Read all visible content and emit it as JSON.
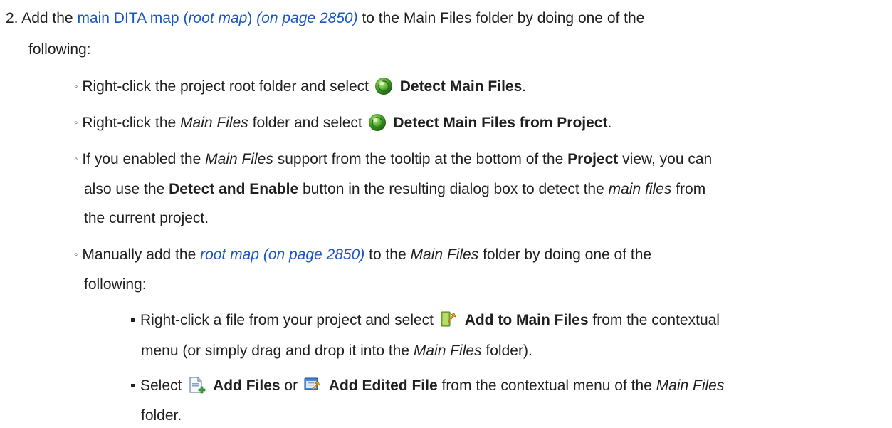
{
  "step": {
    "number": "2.",
    "text_a": "Add the",
    "link_main": "main DITA map (",
    "link_root_map": "root map",
    "link_close": ")",
    "link_page": "(on page 2850)",
    "text_b": "to the Main Files folder by doing one of the",
    "text_c": "following:"
  },
  "options": [
    {
      "bullet": "◦",
      "pre": "Right-click the project root folder and select",
      "icon": "detect-main-files-icon",
      "action": "Detect Main Files",
      "post": "."
    },
    {
      "bullet": "◦",
      "pre": "Right-click the",
      "italic": "Main Files",
      "mid": "folder and select",
      "icon": "detect-main-files-icon",
      "action": "Detect Main Files from Project",
      "post": "."
    },
    {
      "bullet": "◦",
      "l1_pre": "If you enabled the",
      "l1_italic": "Main Files",
      "l1_mid": "support from the tooltip at the bottom of the",
      "l1_bold": "Project",
      "l1_post": "view, you can",
      "l2_pre": "also use the",
      "l2_bold": "Detect and Enable",
      "l2_mid": "button in the resulting dialog box to detect the",
      "l2_italic": "main files",
      "l2_post": "from",
      "l3": "the current project."
    },
    {
      "bullet": "◦",
      "pre": "Manually add the",
      "link": "root map (on page 2850)",
      "mid": "to the",
      "italic": "Main Files",
      "post": "folder by doing one of the",
      "l2": "following:"
    }
  ],
  "sub_options": [
    {
      "pre": "Right-click a file from your project and select",
      "icon": "add-to-main-files-icon",
      "action": "Add to Main Files",
      "post": "from the contextual",
      "l2_pre": "menu (or simply drag and drop it into the",
      "l2_italic": "Main Files",
      "l2_post": "folder)."
    },
    {
      "pre": "Select",
      "icon1": "add-files-icon",
      "action1": "Add Files",
      "or": "or",
      "icon2": "add-edited-file-icon",
      "action2": "Add Edited File",
      "mid": "from the contextual menu of the",
      "italic": "Main Files",
      "l2": "folder."
    }
  ],
  "colors": {
    "link": "#1a57c2",
    "text": "#1f1f1f"
  }
}
